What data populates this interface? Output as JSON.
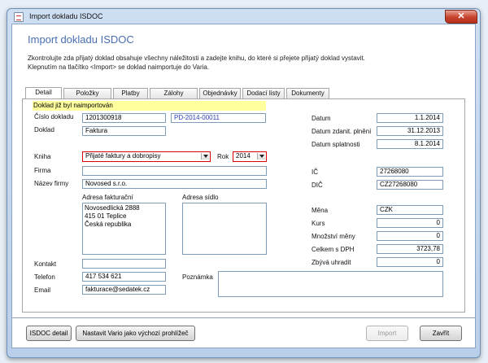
{
  "window": {
    "title": "Import dokladu ISDOC",
    "close_glyph": "✕"
  },
  "header": {
    "title": "Import dokladu ISDOC",
    "description_line1": "Zkontrolujte zda přijatý doklad obsahuje všechny náležitosti a zadejte knihu, do které si přejete přijatý doklad vystavit.",
    "description_line2": "Klepnutím na tlačítko <Import> se doklad naimportuje do Varia."
  },
  "tabs": [
    {
      "label": "Detail",
      "active": true
    },
    {
      "label": "Položky"
    },
    {
      "label": "Platby"
    },
    {
      "label": "Zálohy"
    },
    {
      "label": "Objednávky"
    },
    {
      "label": "Dodací listy"
    },
    {
      "label": "Dokumenty"
    }
  ],
  "detail": {
    "banner": "Doklad již byl naimportován",
    "cislo_dokladu": {
      "label": "Číslo dokladu",
      "value": "1201300918",
      "ref": "PD-2014-00011"
    },
    "doklad": {
      "label": "Doklad",
      "value": "Faktura"
    },
    "kniha": {
      "label": "Kniha",
      "value": "Přijaté faktury a dobropisy"
    },
    "rok": {
      "label": "Rok",
      "value": "2014"
    },
    "firma": {
      "label": "Firma",
      "value": ""
    },
    "nazev_firmy": {
      "label": "Název firmy",
      "value": "Novosed s.r.o."
    },
    "adresa_fakturacni": {
      "label": "Adresa fakturační",
      "lines": [
        "Novosedlická 2888",
        "415 01 Teplice",
        "Česká republika"
      ]
    },
    "adresa_sidlo": {
      "label": "Adresa sídlo",
      "lines": []
    },
    "kontakt": {
      "label": "Kontakt",
      "value": ""
    },
    "telefon": {
      "label": "Telefon",
      "value": "417 534 621"
    },
    "email": {
      "label": "Email",
      "value": "fakturace@sedatek.cz"
    },
    "poznamka": {
      "label": "Poznámka",
      "value": ""
    },
    "datum": {
      "label": "Datum",
      "value": "1.1.2014"
    },
    "datum_zdanit": {
      "label": "Datum zdanit. plnění",
      "value": "31.12.2013"
    },
    "datum_splatnosti": {
      "label": "Datum splatnosti",
      "value": "8.1.2014"
    },
    "ic": {
      "label": "IČ",
      "value": "27268080"
    },
    "dic": {
      "label": "DIČ",
      "value": "CZ27268080"
    },
    "mena": {
      "label": "Měna",
      "value": "CZK"
    },
    "kurs": {
      "label": "Kurs",
      "value": "0"
    },
    "mnozstvi_meny": {
      "label": "Množství měny",
      "value": "0"
    },
    "celkem_s_dph": {
      "label": "Celkem s DPH",
      "value": "3723,78"
    },
    "zbyva_uhradit": {
      "label": "Zbývá uhradit",
      "value": "0"
    }
  },
  "footer": {
    "isdoc_detail": "ISDOC detail",
    "nastavit_vario": "Nastavit Vario jako výchozí prohlížeč",
    "import": "Import",
    "zavrit": "Zavřít"
  },
  "colors": {
    "heading": "#4a6fb3",
    "banner": "#ffff9d",
    "required_border": "#e00000"
  }
}
